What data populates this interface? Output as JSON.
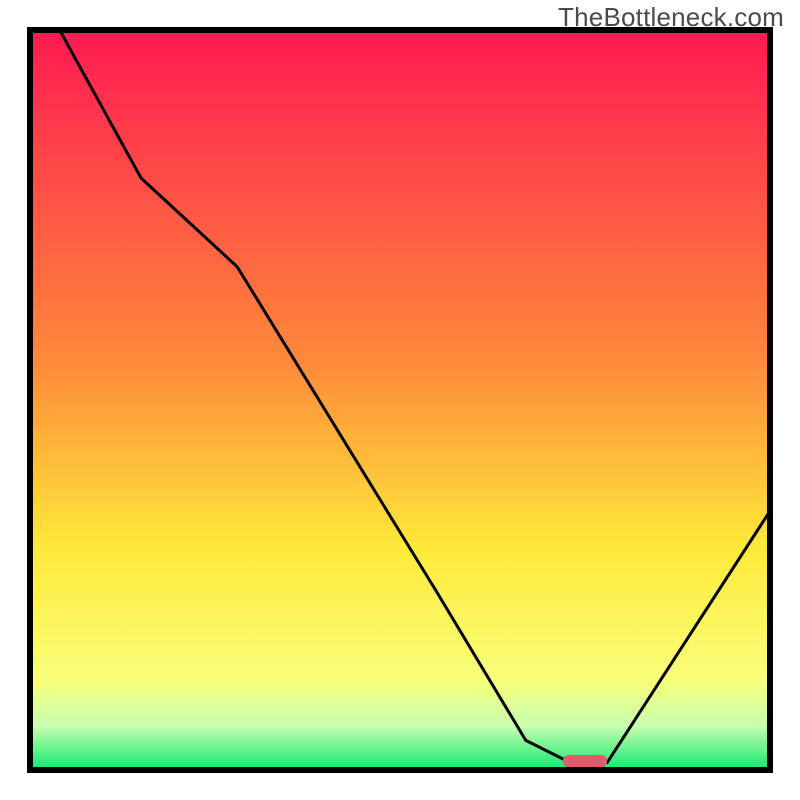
{
  "watermark": "TheBottleneck.com",
  "chart_data": {
    "type": "line",
    "title": "",
    "xlabel": "",
    "ylabel": "",
    "xlim": [
      0,
      100
    ],
    "ylim": [
      0,
      100
    ],
    "background_gradient": {
      "stops": [
        {
          "offset": 0,
          "color": "#ff1a52"
        },
        {
          "offset": 45,
          "color": "#ff8a3a"
        },
        {
          "offset": 70,
          "color": "#ffe93a"
        },
        {
          "offset": 88,
          "color": "#f8ff7a"
        },
        {
          "offset": 94,
          "color": "#c8ffb0"
        },
        {
          "offset": 100,
          "color": "#11e86f"
        }
      ]
    },
    "series": [
      {
        "name": "bottleneck-curve",
        "x": [
          4,
          15,
          28,
          55,
          67,
          73,
          78,
          100
        ],
        "y": [
          100,
          80,
          68,
          24,
          4,
          1,
          1,
          35
        ]
      }
    ],
    "marker": {
      "name": "optimal-marker",
      "x_center": 75,
      "y": 1.2,
      "width": 6,
      "color": "#e05a6a"
    },
    "frame_color": "#000000"
  }
}
